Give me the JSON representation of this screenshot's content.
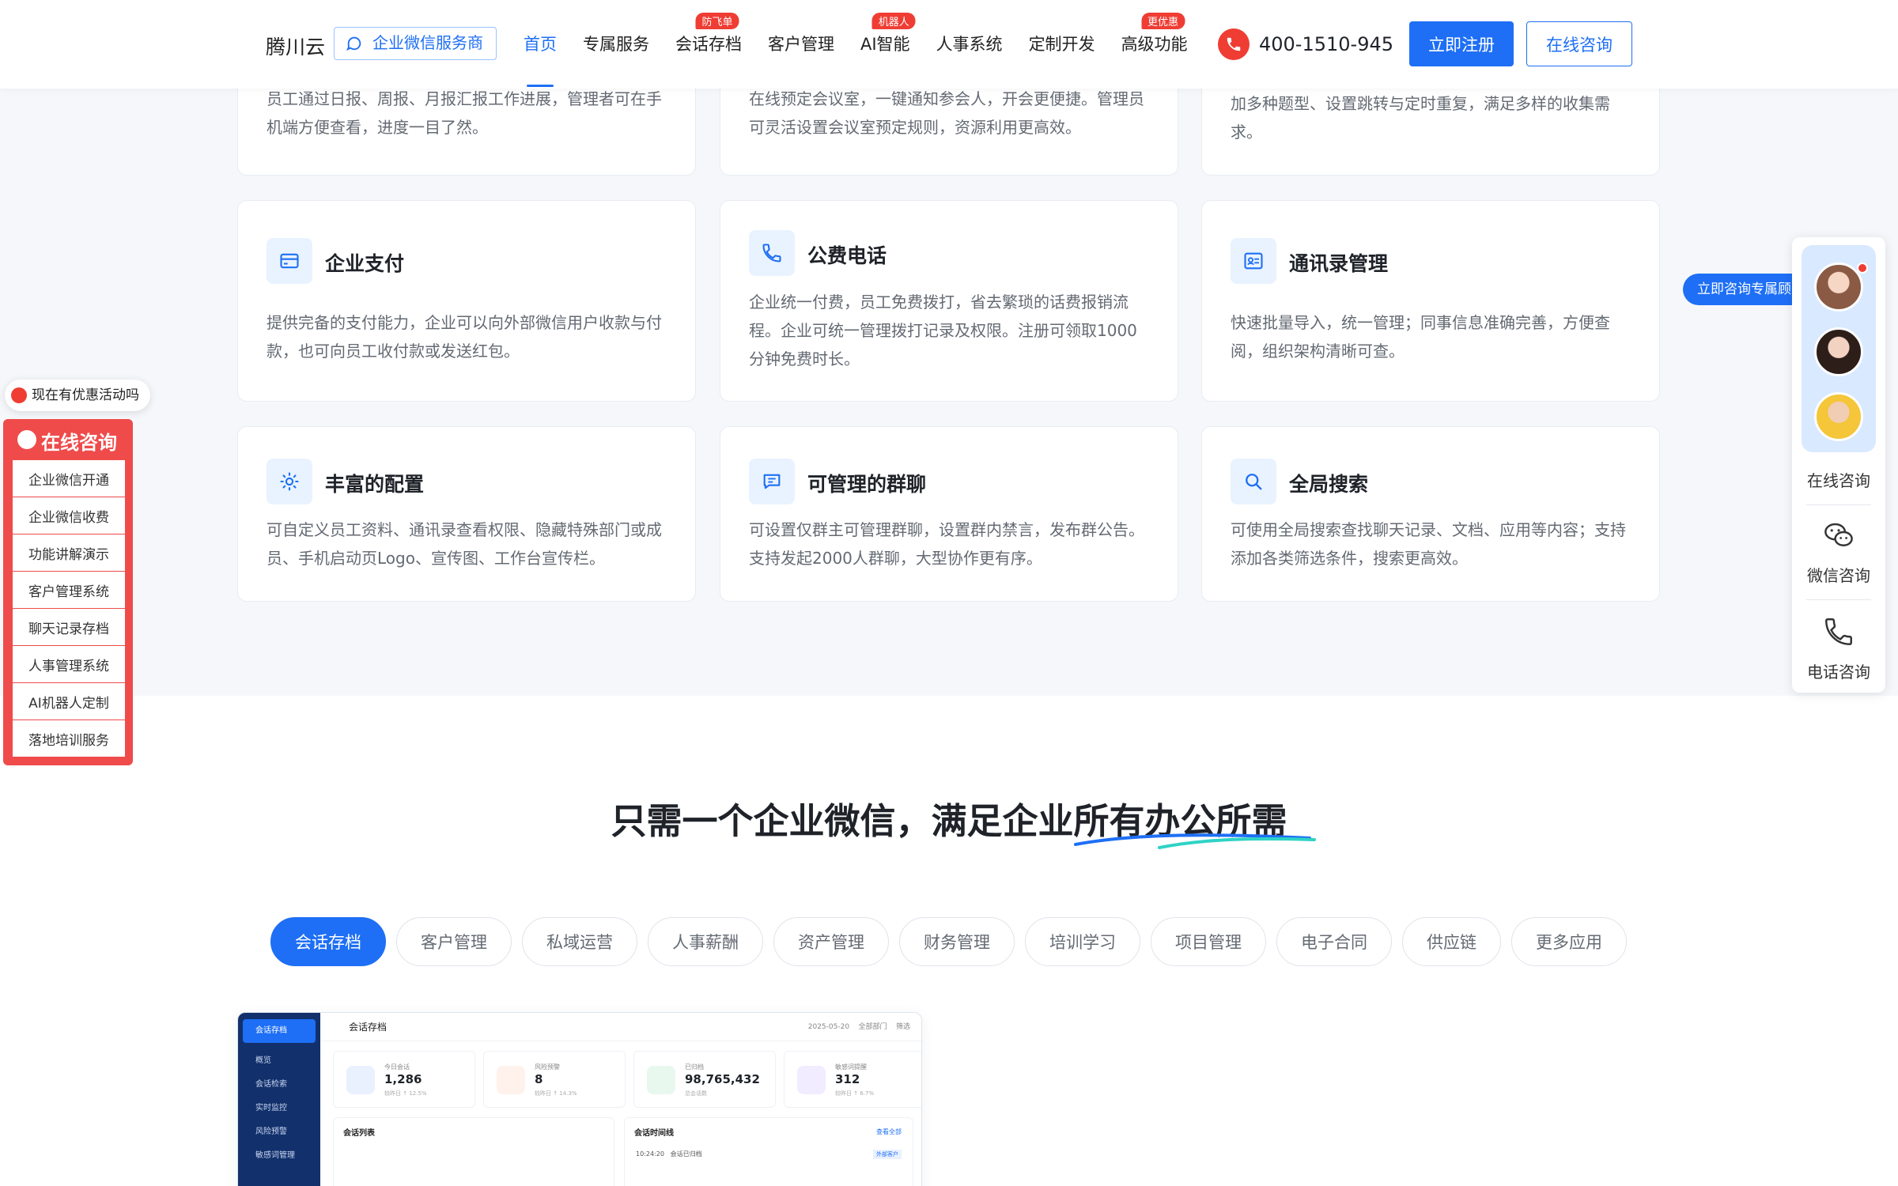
{
  "header": {
    "logo": "腾川云",
    "partner_label": "企业微信服务商",
    "nav": [
      {
        "label": "首页",
        "badge": ""
      },
      {
        "label": "专属服务",
        "badge": ""
      },
      {
        "label": "会话存档",
        "badge": "防飞单"
      },
      {
        "label": "客户管理",
        "badge": ""
      },
      {
        "label": "AI智能",
        "badge": "机器人"
      },
      {
        "label": "人事系统",
        "badge": ""
      },
      {
        "label": "定制开发",
        "badge": ""
      },
      {
        "label": "高级功能",
        "badge": "更优惠"
      }
    ],
    "phone": "400-1510-945",
    "register_label": "立即注册",
    "consult_label": "在线咨询"
  },
  "cards_top": [
    {
      "desc": "员工通过日报、周报、月报汇报工作进展，管理者可在手机端方便查看，进度一目了然。"
    },
    {
      "desc": "在线预定会议室，一键通知参会人，开会更便捷。管理员可灵活设置会议室预定规则，资源利用更高效。"
    },
    {
      "desc": "加多种题型、设置跳转与定时重复，满足多样的收集需求。"
    }
  ],
  "cards": [
    {
      "title": "企业支付",
      "desc": "提供完备的支付能力，企业可以向外部微信用户收款与付款，也可向员工收付款或发送红包。"
    },
    {
      "title": "公费电话",
      "desc": "企业统一付费，员工免费拨打，省去繁琐的话费报销流程。企业可统一管理拨打记录及权限。注册可领取1000分钟免费时长。"
    },
    {
      "title": "通讯录管理",
      "desc": "快速批量导入，统一管理；同事信息准确完善，方便查阅，组织架构清晰可查。"
    },
    {
      "title": "丰富的配置",
      "desc": "可自定义员工资料、通讯录查看权限、隐藏特殊部门或成员、手机启动页Logo、宣传图、工作台宣传栏。"
    },
    {
      "title": "可管理的群聊",
      "desc": "可设置仅群主可管理群聊，设置群内禁言，发布群公告。支持发起2000人群聊，大型协作更有序。"
    },
    {
      "title": "全局搜索",
      "desc": "可使用全局搜索查找聊天记录、文档、应用等内容；支持添加各类筛选条件，搜索更高效。"
    }
  ],
  "section2": {
    "title": "只需一个企业微信，满足企业所有办公所需",
    "tabs": [
      "会话存档",
      "客户管理",
      "私域运营",
      "人事薪酬",
      "资产管理",
      "财务管理",
      "培训学习",
      "项目管理",
      "电子合同",
      "供应链",
      "更多应用"
    ]
  },
  "mock": {
    "title": "会话存档",
    "side": [
      "会话存档",
      "概览",
      "会话检索",
      "实时监控",
      "风险预警",
      "敏感词管理"
    ],
    "date": "2025-05-20",
    "dept": "全部部门",
    "filter": "筛选",
    "stats": [
      {
        "label": "今日会话",
        "value": "1,286",
        "sub": "较昨日 ↑ 12.5%",
        "color": "#e9f1ff"
      },
      {
        "label": "风险预警",
        "value": "8",
        "sub": "较昨日 ↑ 14.3%",
        "color": "#fff1ec"
      },
      {
        "label": "已归档",
        "value": "98,765,432",
        "sub": "总会话数",
        "color": "#e8f8ee"
      },
      {
        "label": "敏感词提醒",
        "value": "312",
        "sub": "较昨日 ↑ 6.7%",
        "color": "#f1ecff"
      }
    ],
    "list_title": "会话列表",
    "timeline_title": "会话时间线",
    "timeline_more": "查看全部",
    "timeline_item": "会话已归档",
    "timeline_time": "10:24:20",
    "timeline_tag": "外部客户"
  },
  "left_float": {
    "promo": "现在有优惠活动吗",
    "title": "在线咨询",
    "items": [
      "企业微信开通",
      "企业微信收费",
      "功能讲解演示",
      "客户管理系统",
      "聊天记录存档",
      "人事管理系统",
      "AI机器人定制",
      "落地培训服务"
    ]
  },
  "right_float": {
    "tip": "立即咨询专属顾问",
    "online": "在线咨询",
    "wechat": "微信咨询",
    "phone": "电话咨询"
  },
  "colors": {
    "primary": "#1e6ff5",
    "red": "#ef3d34"
  }
}
